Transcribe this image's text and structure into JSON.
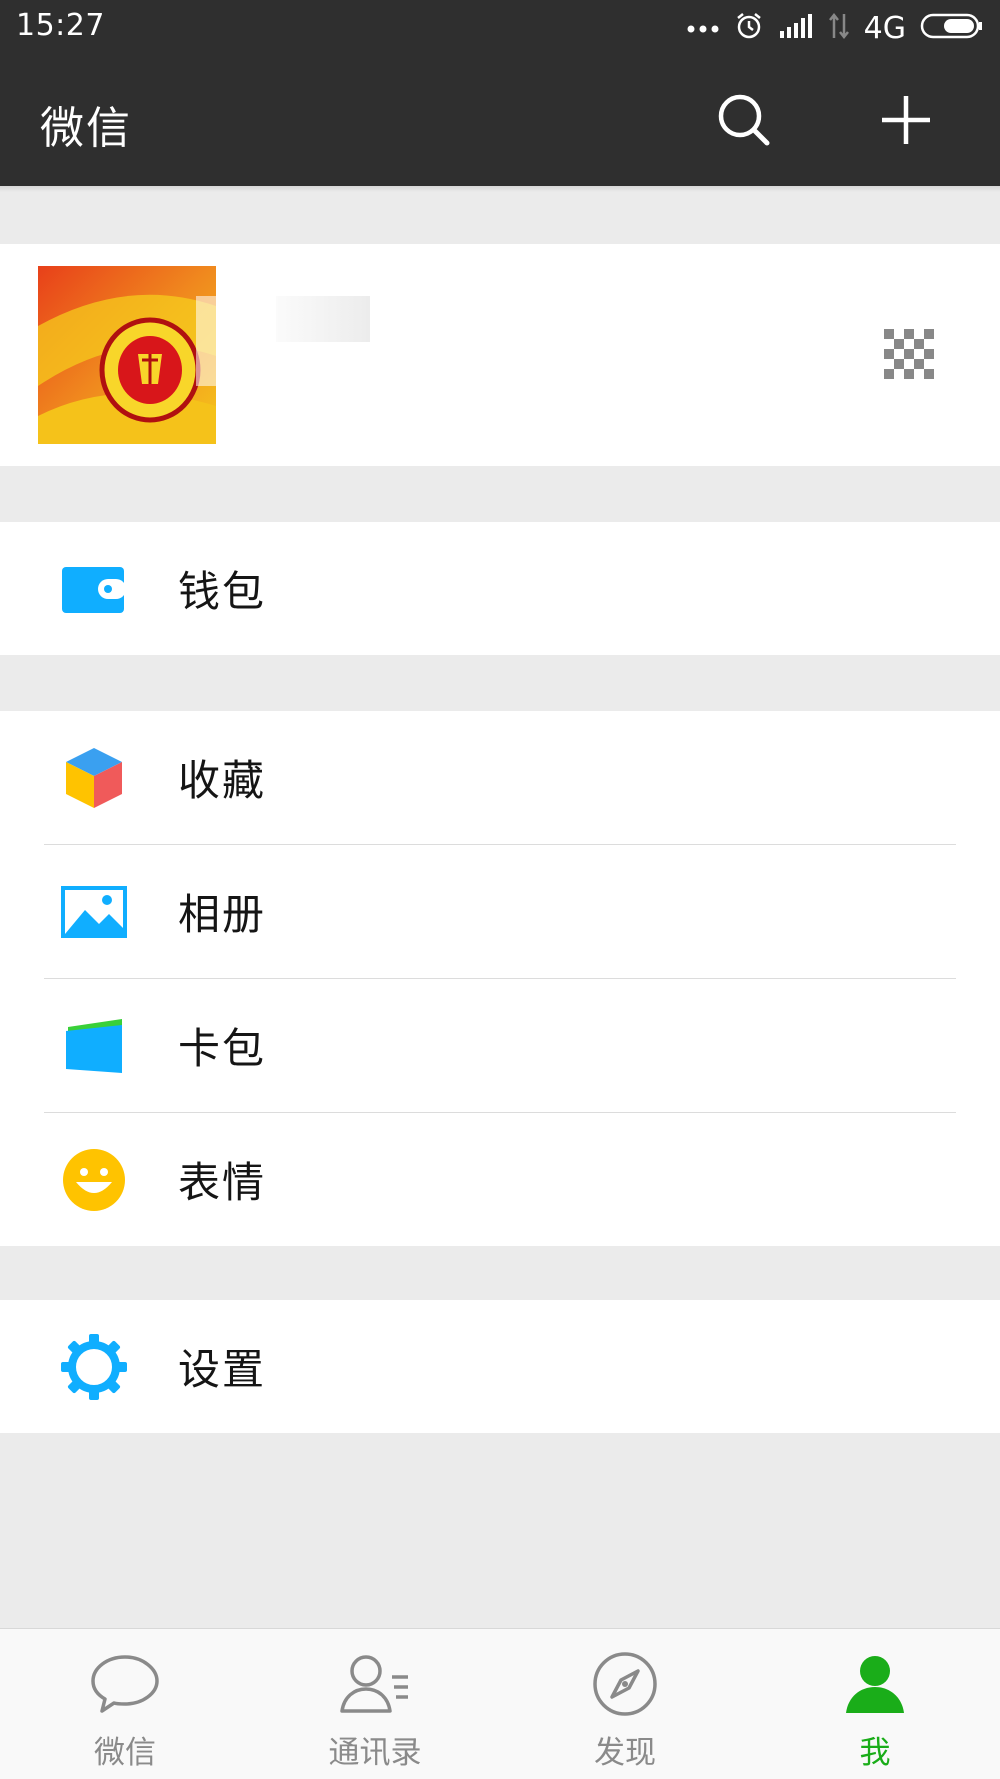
{
  "status_bar": {
    "time": "15:27",
    "network": "4G"
  },
  "app_bar": {
    "title": "微信"
  },
  "menu": {
    "wallet": "钱包",
    "favorites": "收藏",
    "album": "相册",
    "card_pack": "卡包",
    "stickers": "表情",
    "settings": "设置"
  },
  "tabs": {
    "chats": "微信",
    "contacts": "通讯录",
    "discover": "发现",
    "me": "我"
  },
  "colors": {
    "bar": "#2f2f2f",
    "accent_green": "#1aad19",
    "icon_blue": "#10aeff",
    "sticker_yellow": "#ffc300"
  }
}
